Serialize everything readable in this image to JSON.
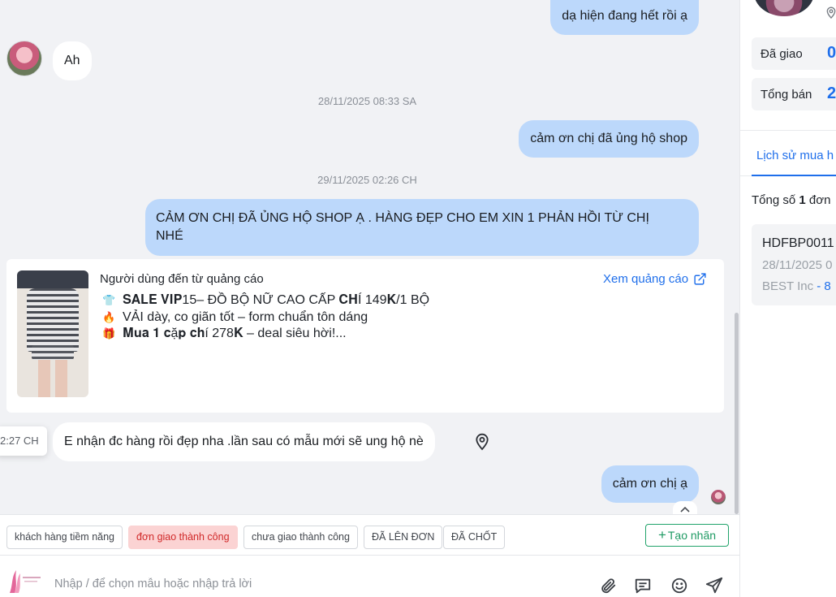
{
  "chat": {
    "messages": [
      {
        "dir": "out",
        "text": "dạ hiện đang hết rồi ạ"
      },
      {
        "dir": "in",
        "text": "Ah"
      },
      {
        "dir": "out",
        "text": "cảm ơn chị đã ủng hộ shop"
      },
      {
        "dir": "out",
        "text_line1": "CẢM ƠN CHỊ ĐÃ ỦNG HỘ SHOP Ạ . HÀNG ĐẸP CHO EM XIN 1 PHẢN HỒI TỪ CHỊ",
        "text_line2": "NHÉ"
      },
      {
        "dir": "in",
        "text": "E nhận đc hàng rồi đẹp nha .lần sau có mẫu mới sẽ ung hộ nè"
      },
      {
        "dir": "out",
        "text": "cảm ơn chị ạ"
      }
    ],
    "timestamps": [
      "28/11/2025 08:33 SA",
      "29/11/2025 02:26 CH"
    ],
    "time_tooltip": "2:27 CH",
    "ad": {
      "title": "Người dùng đến từ quảng cáo",
      "link": "Xem quảng cáo",
      "lines": [
        {
          "emoji": "👕",
          "text": "𝐒𝐀𝐋𝐄 𝐕𝐈𝐏15– ĐỒ BỘ NỮ CAO CẤP 𝐂𝐇Í 149𝐊/1 BỘ"
        },
        {
          "emoji": "🔥",
          "text": "VẢI dày, co giãn tốt – form chuẩn tôn dáng"
        },
        {
          "emoji": "🎁",
          "text": "𝐌𝐮𝐚 𝟏 𝐜ặ𝐩 𝐜𝐡í 278𝐊 – deal siêu hời!..."
        }
      ]
    },
    "icons": {
      "pin": "map-pin-icon",
      "scroll_up": "chevron-up-icon"
    }
  },
  "tags": [
    "khách hàng tiềm năng",
    "đơn giao thành công",
    "chưa giao thành công",
    "ĐÃ LÊN ĐƠN",
    "ĐÃ CHỐT"
  ],
  "active_tag_index": 1,
  "create_tag": {
    "plus": "+",
    "label": "Tạo nhãn"
  },
  "composer": {
    "placeholder": "Nhập / để chọn mẫu hoặc nhập trả lời",
    "icons": [
      "attach-icon",
      "quick-reply-icon",
      "emoji-icon",
      "send-icon"
    ]
  },
  "panel": {
    "stats": [
      {
        "label": "Đã giao",
        "value": "0"
      },
      {
        "label": "Tổng bán",
        "value": "2"
      }
    ],
    "tab": "Lịch sử mua h",
    "total_prefix": "Tổng số ",
    "total_count": "1",
    "total_suffix": " đơn",
    "order": {
      "id": "HDFBP0011",
      "date": "28/11/2025 0",
      "carrier": "BEST Inc",
      "amount": " - 8"
    }
  },
  "colors": {
    "outgoing_bubble": "#bcd8fb",
    "incoming_bubble": "#ffffff",
    "chat_bg": "#f1f2f5",
    "accent": "#1f6feb",
    "active_tag_bg": "#fbd3d3",
    "active_tag_text": "#d12a2a",
    "create_tag": "#1e9a63"
  }
}
